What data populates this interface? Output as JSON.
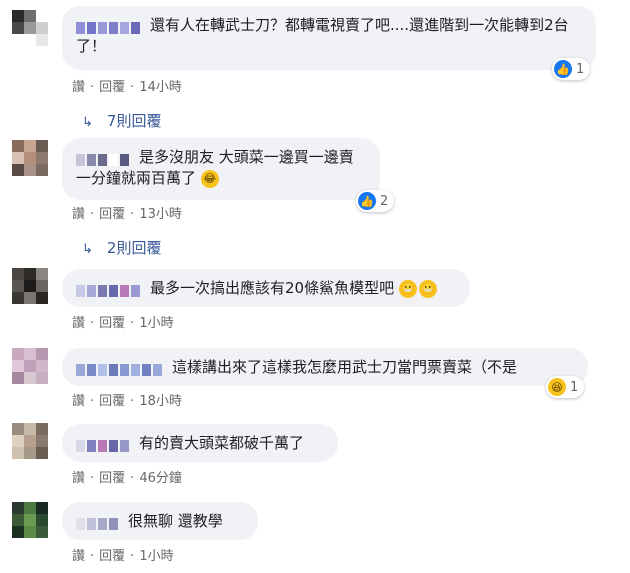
{
  "comments": [
    {
      "text": "還有人在轉武士刀？都轉電視賣了吧....還進階到一次能轉到2台了！",
      "actions": {
        "like": "讚",
        "reply": "回覆",
        "time": "14小時"
      },
      "reaction": {
        "icon": "like-icon",
        "count": "1"
      },
      "replies_label": "7則回覆",
      "avatar_colors": [
        "#2b2b2b",
        "#6f6f6f",
        "#ffffff",
        "#4a4a4a",
        "#9a9a9a",
        "#cfcfcf",
        "#ffffff",
        "#ffffff",
        "#e8e8e8"
      ],
      "name_colors": [
        "#8f8fd8",
        "#7373c8",
        "#9999d8",
        "#7d7dca",
        "#a6a6df",
        "#6a6ab8"
      ]
    },
    {
      "text": "是多沒朋友 大頭菜一邊買一邊賣一分鐘就兩百萬了",
      "emoji": "laugh-cry-emoji",
      "actions": {
        "like": "讚",
        "reply": "回覆",
        "time": "13小時"
      },
      "reaction": {
        "icon": "like-icon",
        "count": "2"
      },
      "replies_label": "2則回覆",
      "avatar_colors": [
        "#8a6b5a",
        "#c7a48f",
        "#6b5a52",
        "#d8c2b4",
        "#b38f7a",
        "#8d7a6e",
        "#5a4a44",
        "#a8928a",
        "#7a6a62"
      ],
      "name_colors": [
        "#c6c6d8",
        "#8888a8",
        "#6b6b8f",
        "#ffffff",
        "#5a5a80"
      ]
    },
    {
      "text": "最多一次搞出應該有20條鯊魚模型吧",
      "emoji": "grimace-emoji",
      "actions": {
        "like": "讚",
        "reply": "回覆",
        "time": "1小時"
      },
      "avatar_colors": [
        "#4a4540",
        "#2e2a26",
        "#8a8580",
        "#5a5550",
        "#1e1c1a",
        "#6a6560",
        "#3a3632",
        "#7a7570",
        "#2a2622"
      ],
      "name_colors": [
        "#c8c8e8",
        "#a8a8d8",
        "#7a7ab0",
        "#6868b0",
        "#b878b8",
        "#9a9ad0"
      ]
    },
    {
      "text": "這樣講出來了這樣我怎麼用武士刀當門票賣菜（不是",
      "actions": {
        "like": "讚",
        "reply": "回覆",
        "time": "18小時"
      },
      "reaction": {
        "icon": "haha-icon",
        "count": "1"
      },
      "avatar_colors": [
        "#c9a8c0",
        "#d8c0d0",
        "#b898b0",
        "#e0c8d8",
        "#c0a0b8",
        "#d0b8c8",
        "#a888a0",
        "#d8c8d0",
        "#c8b0c0"
      ],
      "name_colors": [
        "#9aa8d8",
        "#7a8ac8",
        "#b0c0e8",
        "#6a7ab8",
        "#8898d0",
        "#a0b0e0",
        "#7080c0",
        "#98a8d8"
      ]
    },
    {
      "text": "有的賣大頭菜都破千萬了",
      "actions": {
        "like": "讚",
        "reply": "回覆",
        "time": "46分鐘"
      },
      "avatar_colors": [
        "#9a8a80",
        "#c8b8a8",
        "#7a6a60",
        "#e0d0c0",
        "#b8a090",
        "#8a7a70",
        "#d0c0b0",
        "#a89888",
        "#6a5a50"
      ],
      "name_colors": [
        "#d8d8e8",
        "#8080c0",
        "#b878b8",
        "#6868a8",
        "#9898c8"
      ]
    },
    {
      "text": "很無聊 還教學",
      "actions": {
        "like": "讚",
        "reply": "回覆",
        "time": "1小時"
      },
      "avatar_colors": [
        "#2a3a30",
        "#4a7a40",
        "#1a2a22",
        "#3a5a38",
        "#6a9a50",
        "#2a4a30",
        "#1a3020",
        "#5a8a48",
        "#3a5a3a"
      ],
      "name_colors": [
        "#e0e0ea",
        "#c0c0d8",
        "#a8a8c8",
        "#9090b8"
      ]
    }
  ]
}
